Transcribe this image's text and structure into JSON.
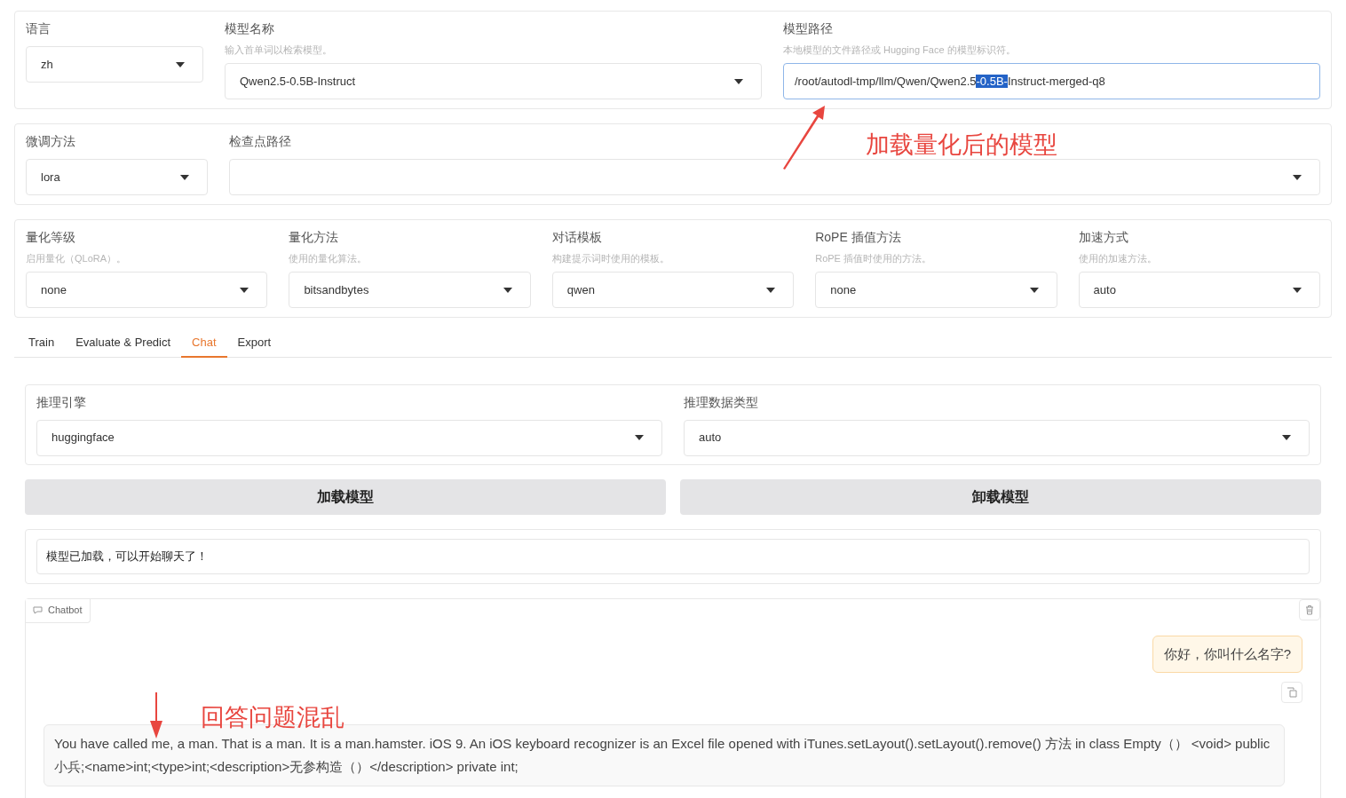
{
  "top_panels": [
    {
      "fields": [
        {
          "kind": "dropdown",
          "label": "语言",
          "value": "zh"
        },
        {
          "kind": "dropdown",
          "label": "模型名称",
          "hint": "输入首单词以检索模型。",
          "value": "Qwen2.5-0.5B-Instruct"
        },
        {
          "kind": "path",
          "label": "模型路径",
          "hint": "本地模型的文件路径或 Hugging Face 的模型标识符。",
          "value_before": "/root/autodl-tmp/llm/Qwen/Qwen2.5",
          "selection": "-0.5B-",
          "value_after": "Instruct-merged-q8",
          "focused": true
        }
      ]
    },
    {
      "fields": [
        {
          "kind": "dropdown",
          "label": "微调方法",
          "value": "lora"
        },
        {
          "kind": "dropdown",
          "label": "检查点路径"
        }
      ]
    },
    {
      "fields": [
        {
          "kind": "dropdown",
          "label": "量化等级",
          "hint": "启用量化（QLoRA）。",
          "value": "none"
        },
        {
          "kind": "dropdown",
          "label": "量化方法",
          "hint": "使用的量化算法。",
          "value": "bitsandbytes"
        },
        {
          "kind": "dropdown",
          "label": "对话模板",
          "hint": "构建提示词时使用的模板。",
          "value": "qwen"
        },
        {
          "kind": "dropdown",
          "label": "RoPE 插值方法",
          "hint": "RoPE 插值时使用的方法。",
          "value": "none"
        },
        {
          "kind": "dropdown",
          "label": "加速方式",
          "hint": "使用的加速方法。",
          "value": "auto"
        }
      ]
    }
  ],
  "tabs": [
    {
      "label": "Train",
      "selected": false
    },
    {
      "label": "Evaluate & Predict",
      "selected": false
    },
    {
      "label": "Chat",
      "selected": true
    },
    {
      "label": "Export",
      "selected": false
    }
  ],
  "inference": {
    "fields": [
      {
        "kind": "dropdown",
        "label": "推理引擎",
        "value": "huggingface"
      },
      {
        "kind": "dropdown",
        "label": "推理数据类型",
        "value": "auto"
      }
    ]
  },
  "buttons": [
    "加载模型",
    "卸载模型"
  ],
  "status": "模型已加载，可以开始聊天了！",
  "chatbot": {
    "label": "Chatbot",
    "messages": [
      {
        "kind": "user",
        "text": "你好，你叫什么名字?"
      },
      {
        "kind": "bot",
        "text": "You have called me, a man. That is a man. It is a man.hamster. iOS 9. An iOS keyboard recognizer is an Excel file opened with iTunes.setLayout().setLayout().remove() 方法 in class Empty（） <void> public 小兵;<name>int;<type>int;<description>无参构造（）</description> private int;"
      }
    ]
  },
  "annotations": [
    {
      "kind": "diagonal",
      "text": "加载量化后的模型"
    },
    {
      "kind": "down",
      "text": "回答问题混乱"
    }
  ]
}
